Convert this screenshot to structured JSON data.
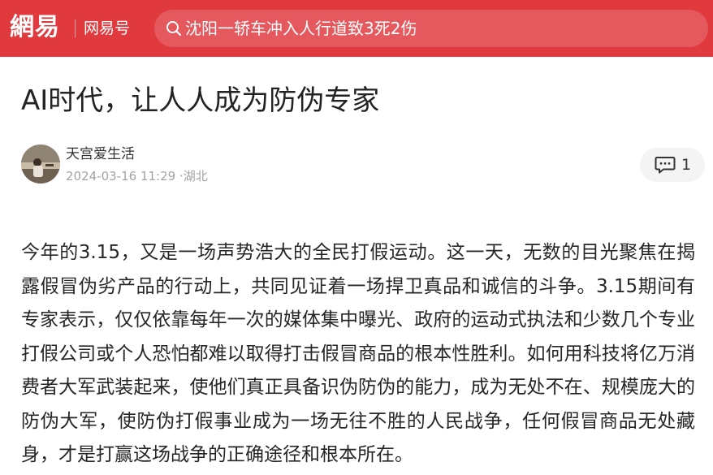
{
  "header": {
    "logo_text": "網易",
    "channel_label": "网易号",
    "search_text": "沈阳一轿车冲入人行道致3死2伤",
    "brand_color": "#e0393e"
  },
  "article": {
    "title": "AI时代，让人人成为防伪专家",
    "author": "天宫爱生活",
    "meta": "2024-03-16 11:29 ·湖北",
    "comment_count": "1",
    "body": "今年的3.15，又是一场声势浩大的全民打假运动。这一天，无数的目光聚焦在揭露假冒伪劣产品的行动上，共同见证着一场捍卫真品和诚信的斗争。3.15期间有专家表示，仅仅依靠每年一次的媒体集中曝光、政府的运动式执法和少数几个专业打假公司或个人恐怕都难以取得打击假冒商品的根本性胜利。如何用科技将亿万消费者大军武装起来，使他们真正具备识伪防伪的能力，成为无处不在、规模庞大的防伪大军，使防伪打假事业成为一场无往不胜的人民战争，任何假冒商品无处藏身，才是打赢这场战争的正确途径和根本所在。"
  },
  "icons": {
    "search": "search-icon",
    "comment": "comment-icon",
    "avatar": "author-avatar"
  }
}
